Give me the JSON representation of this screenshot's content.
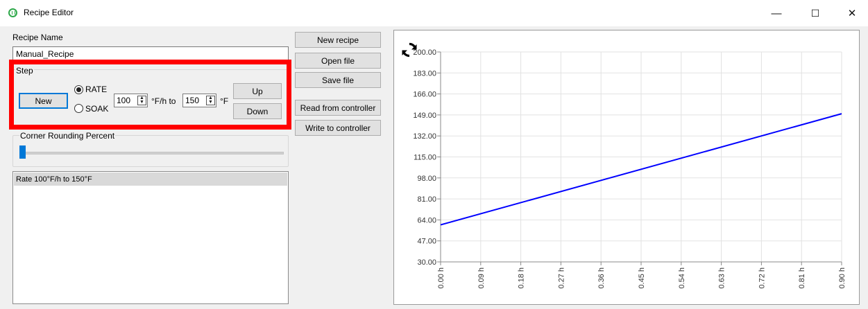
{
  "window": {
    "title": "Recipe Editor",
    "minimize_glyph": "—",
    "maximize_glyph": "☐",
    "close_glyph": "✕"
  },
  "recipe": {
    "name_label": "Recipe Name",
    "name_value": "Manual_Recipe"
  },
  "step": {
    "group_label": "Step",
    "new_label": "New",
    "rate_label": "RATE",
    "soak_label": "SOAK",
    "rate_selected": true,
    "rate_value": "100",
    "rate_unit": "°F/h to",
    "target_value": "150",
    "target_unit": "°F",
    "up_label": "Up",
    "down_label": "Down"
  },
  "corner": {
    "label": "Corner Rounding Percent",
    "slider_value_fraction": 0.0
  },
  "steps_list": {
    "items": [
      "Rate 100°F/h to 150°F"
    ]
  },
  "actions": {
    "new_recipe": "New recipe",
    "open_file": "Open file",
    "save_file": "Save file",
    "read_controller": "Read from controller",
    "write_controller": "Write to controller"
  },
  "colors": {
    "line": "#0000ff",
    "highlight": "#ff0000",
    "accent": "#0078d7"
  },
  "chart_data": {
    "type": "line",
    "title": "",
    "xlabel": "",
    "ylabel": "",
    "x_ticks": [
      "0.00 h",
      "0.09 h",
      "0.18 h",
      "0.27 h",
      "0.36 h",
      "0.45 h",
      "0.54 h",
      "0.63 h",
      "0.72 h",
      "0.81 h",
      "0.90 h"
    ],
    "y_ticks": [
      "200.00",
      "183.00",
      "166.00",
      "149.00",
      "132.00",
      "115.00",
      "98.00",
      "81.00",
      "64.00",
      "47.00",
      "30.00"
    ],
    "xlim": [
      0,
      0.9
    ],
    "ylim": [
      30,
      200
    ],
    "grid": true,
    "series": [
      {
        "x": [
          0.0,
          0.9
        ],
        "y": [
          60,
          150
        ]
      }
    ]
  }
}
